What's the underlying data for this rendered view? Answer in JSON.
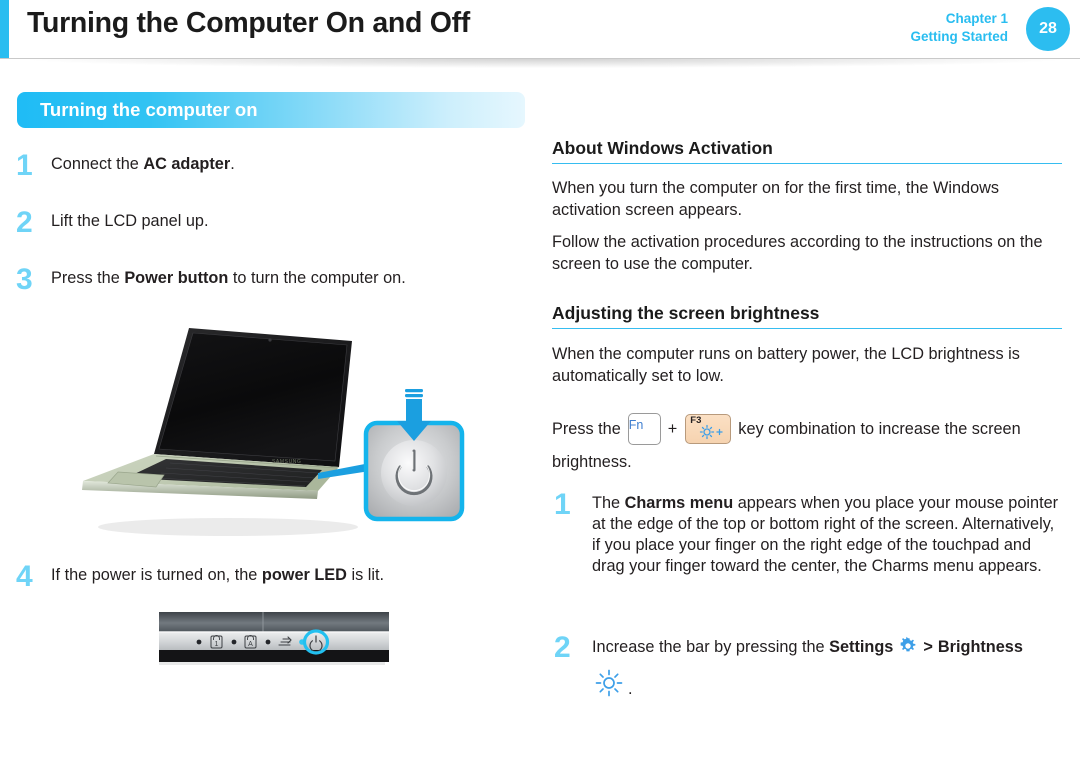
{
  "header": {
    "title": "Turning the Computer On and Off",
    "chapter_line_1": "Chapter 1",
    "chapter_line_2": "Getting Started",
    "page_number": "28",
    "accent_color": "#29bdf0",
    "badge_color": "#2cbdf0"
  },
  "section": {
    "title": "Turning the computer on",
    "bar_gradient_start": "#1fbcf5",
    "bar_gradient_end": "#e6f7fe"
  },
  "left_column": {
    "steps": [
      {
        "number": "1",
        "text_before": "Connect the ",
        "text_bold": "AC adapter",
        "text_after": "."
      },
      {
        "number": "2",
        "text_before": "Lift the LCD panel up.",
        "text_bold": "",
        "text_after": ""
      },
      {
        "number": "3",
        "text_before": "Press the ",
        "text_bold": "Power button",
        "text_after": " to turn the computer on."
      },
      {
        "number": "4",
        "text_before": "If the power is turned on, the ",
        "text_bold": "power LED",
        "text_after": " is lit."
      }
    ],
    "laptop_figure": {
      "name": "laptop-open-with-power-button-callout",
      "brand_text": "SAMSUNG",
      "callout_border_color": "#14b4ec",
      "arrow_color": "#1b9fe0"
    },
    "led_figure": {
      "name": "led-indicator-strip",
      "highlight_color": "#22c0f0",
      "indicators": [
        "caps-lock-icon",
        "num-lock-icon",
        "hdd-activity-icon",
        "power-icon"
      ]
    }
  },
  "right_column": {
    "heading_activation": "About Windows Activation",
    "para_activation_1": "When you turn the computer on for the first time, the Windows activation screen appears.",
    "para_activation_2": "Follow the activation procedures according to the instructions on the screen to use the computer.",
    "heading_brightness": "Adjusting the screen brightness",
    "para_brightness": "When the computer runs on battery power, the LCD brightness is automatically set to low.",
    "press_key": {
      "prefix": "Press the",
      "key_fn_label": "Fn",
      "plus": "+",
      "key_f3_label": "F3",
      "key_f3_icon": "brightness-up-icon",
      "suffix": "key combination to increase the screen",
      "continuation": "brightness."
    },
    "steps": [
      {
        "number": "1",
        "text_before": "The ",
        "text_bold": "Charms menu",
        "text_after": " appears when you place your mouse pointer at the edge of the top or bottom right of the screen. Alternatively, if you place your finger on the right edge of the touchpad and drag your finger toward the center, the Charms menu appears."
      },
      {
        "number": "2",
        "text_before": "Increase the bar by pressing the ",
        "text_bold_1": "Settings",
        "settings_icon": "gear-icon",
        "separator": ">",
        "text_bold_2": "Brightness",
        "brightness_icon": "sun-icon",
        "text_after": "."
      }
    ]
  },
  "colors": {
    "step_number": "#6fd4f7",
    "heading_rule": "#36bdf0",
    "icon_blue": "#3d9fe8",
    "body_text": "#231f20"
  }
}
